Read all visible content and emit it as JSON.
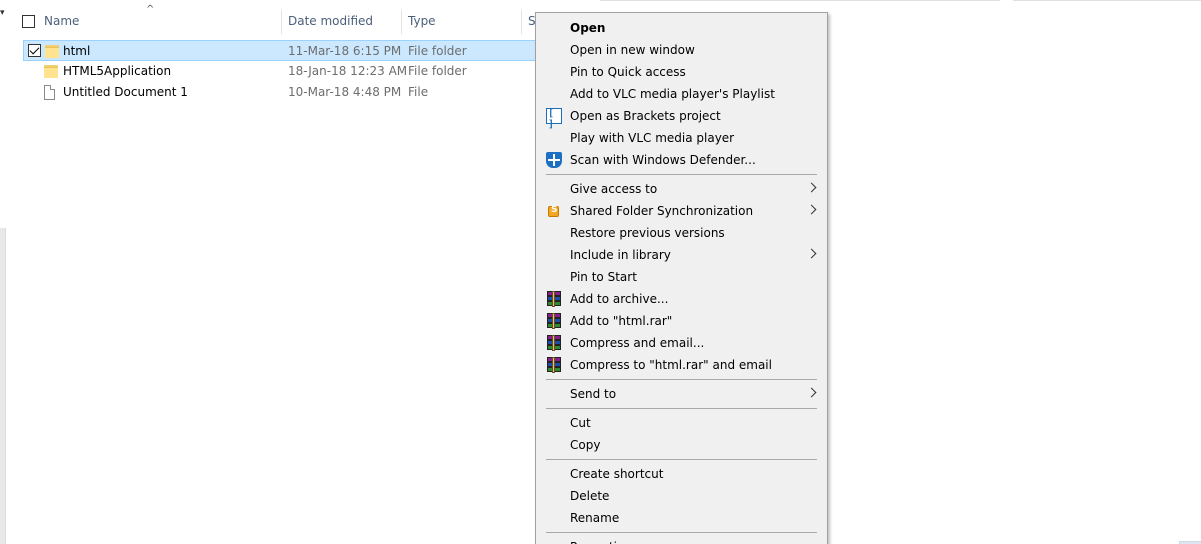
{
  "columns": {
    "name": "Name",
    "date_modified": "Date modified",
    "type": "Type",
    "size_partial": "S"
  },
  "files": [
    {
      "name": "html",
      "date": "11-Mar-18 6:15 PM",
      "type": "File folder",
      "icon": "folder-icon",
      "selected": true
    },
    {
      "name": "HTML5Application",
      "date": "18-Jan-18 12:23 AM",
      "type": "File folder",
      "icon": "folder-icon",
      "selected": false
    },
    {
      "name": "Untitled Document 1",
      "date": "10-Mar-18 4:48 PM",
      "type": "File",
      "icon": "file-icon",
      "selected": false
    }
  ],
  "context_menu": {
    "items": [
      {
        "label": "Open",
        "bold": true
      },
      {
        "label": "Open in new window"
      },
      {
        "label": "Pin to Quick access"
      },
      {
        "label": "Add to VLC media player's Playlist"
      },
      {
        "label": "Open as Brackets project",
        "icon": "brackets-icon"
      },
      {
        "label": "Play with VLC media player"
      },
      {
        "label": "Scan with Windows Defender...",
        "icon": "windows-defender-icon"
      },
      {
        "label": "Give access to",
        "submenu": true
      },
      {
        "label": "Shared Folder Synchronization",
        "icon": "shared-folder-sync-icon",
        "submenu": true
      },
      {
        "label": "Restore previous versions"
      },
      {
        "label": "Include in library",
        "submenu": true
      },
      {
        "label": "Pin to Start"
      },
      {
        "label": "Add to archive...",
        "icon": "winrar-icon"
      },
      {
        "label": "Add to \"html.rar\"",
        "icon": "winrar-icon"
      },
      {
        "label": "Compress and email...",
        "icon": "winrar-icon"
      },
      {
        "label": "Compress to \"html.rar\" and email",
        "icon": "winrar-icon"
      },
      {
        "label": "Send to",
        "submenu": true
      },
      {
        "label": "Cut"
      },
      {
        "label": "Copy"
      },
      {
        "label": "Create shortcut"
      },
      {
        "label": "Delete"
      },
      {
        "label": "Rename"
      },
      {
        "label": "Properties"
      }
    ]
  },
  "colors": {
    "selection_bg": "#cce8ff",
    "selection_border": "#99d1ff",
    "menu_bg": "#f0f0f0",
    "header_text": "#4c607a"
  }
}
